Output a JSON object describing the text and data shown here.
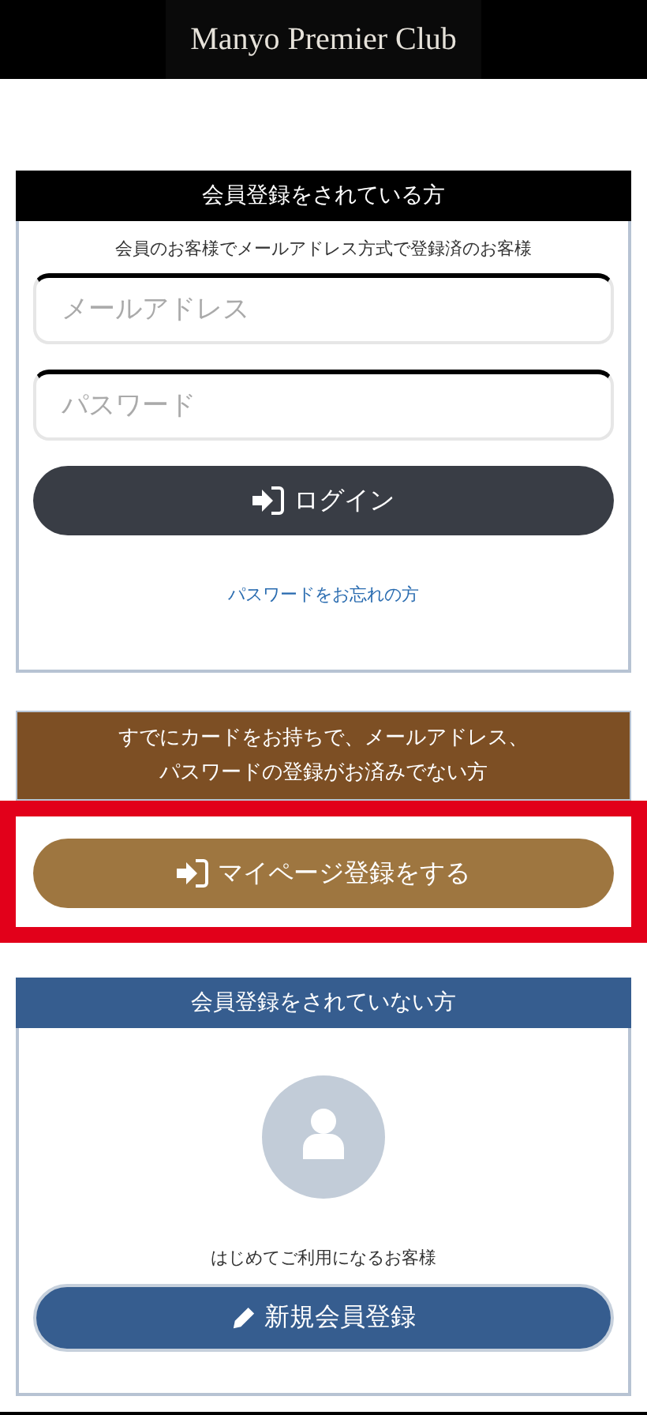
{
  "header": {
    "title": "Manyo Premier Club"
  },
  "member_card": {
    "title": "会員登録をされている方",
    "subtitle": "会員のお客様でメールアドレス方式で登録済のお客様",
    "email": {
      "placeholder": "メールアドレス"
    },
    "password": {
      "placeholder": "パスワード"
    },
    "login_button": "ログイン",
    "forgot_link": "パスワードをお忘れの方"
  },
  "card_holder": {
    "title_lines": [
      "すでにカードをお持ちで、メールアドレス、",
      "パスワードの登録がお済みでない方"
    ],
    "button": "マイページ登録をする",
    "highlighted": true
  },
  "new_member_card": {
    "title": "会員登録をされていない方",
    "caption": "はじめてご利用になるお客様",
    "button": "新規会員登録"
  }
}
